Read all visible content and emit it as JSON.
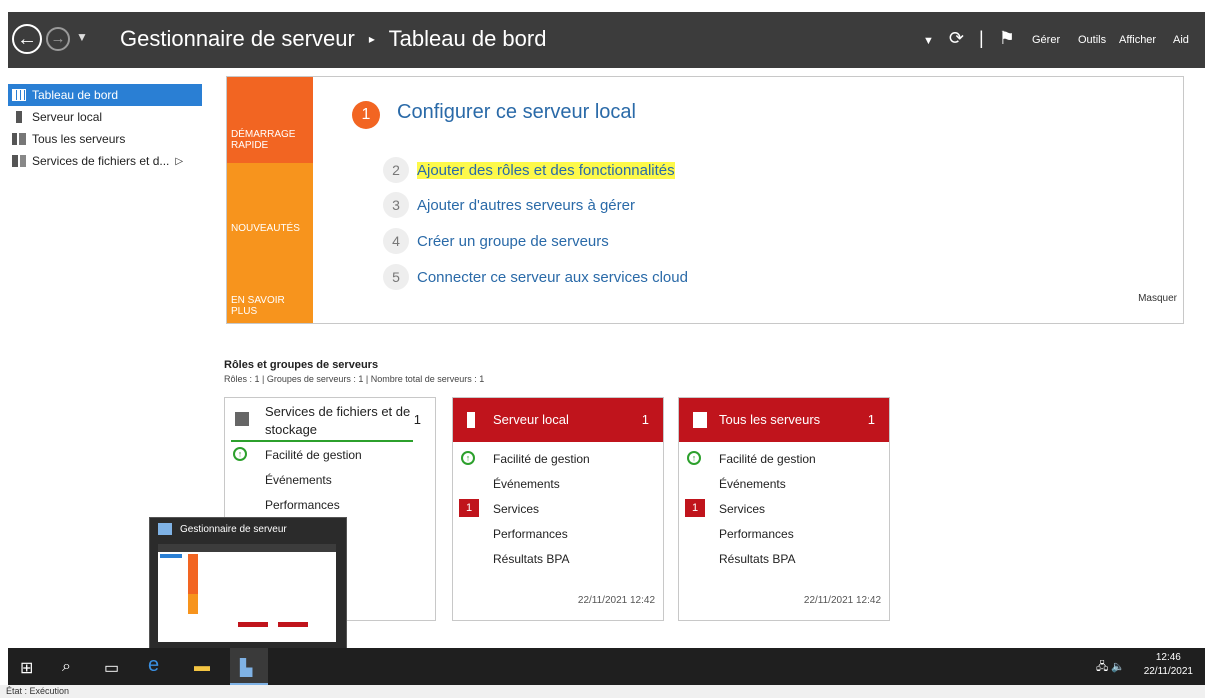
{
  "topbar": {
    "breadcrumb_root": "Gestionnaire de serveur",
    "breadcrumb_sep": "▸",
    "breadcrumb_page": "Tableau de bord",
    "menu": [
      "Gérer",
      "Outils",
      "Afficher",
      "Aid"
    ]
  },
  "sidebar": {
    "items": [
      {
        "label": "Tableau de bord",
        "icon": "dashboard-grid-icon",
        "active": true
      },
      {
        "label": "Serveur local",
        "icon": "server-icon"
      },
      {
        "label": "Tous les serveurs",
        "icon": "servers-icon"
      },
      {
        "label": "Services de fichiers et d...",
        "icon": "file-services-icon",
        "arrow": "▷"
      }
    ]
  },
  "welcome": {
    "strips": [
      "DÉMARRAGE RAPIDE",
      "NOUVEAUTÉS",
      "EN SAVOIR PLUS"
    ],
    "step1": {
      "num": "1",
      "label": "Configurer ce serveur local"
    },
    "steps": [
      {
        "num": "2",
        "label": "Ajouter des rôles et des fonctionnalités"
      },
      {
        "num": "3",
        "label": "Ajouter d'autres serveurs à gérer"
      },
      {
        "num": "4",
        "label": "Créer un groupe de serveurs"
      },
      {
        "num": "5",
        "label": "Connecter ce serveur aux services cloud"
      }
    ],
    "hide": "Masquer"
  },
  "roles": {
    "title": "Rôles et groupes de serveurs",
    "subtitle": "Rôles : 1   |   Groupes de serveurs : 1   |   Nombre total de serveurs : 1"
  },
  "tiles": [
    {
      "title": "Services de fichiers et de stockage",
      "count": "1",
      "rows": [
        "Facilité de gestion",
        "Événements",
        "Performances"
      ]
    },
    {
      "title": "Serveur local",
      "count": "1",
      "rows": [
        "Facilité de gestion",
        "Événements",
        "Services",
        "Performances",
        "Résultats BPA"
      ],
      "services_badge": "1",
      "timestamp": "22/11/2021 12:42"
    },
    {
      "title": "Tous les serveurs",
      "count": "1",
      "rows": [
        "Facilité de gestion",
        "Événements",
        "Services",
        "Performances",
        "Résultats BPA"
      ],
      "services_badge": "1",
      "timestamp": "22/11/2021 12:42"
    }
  ],
  "preview": {
    "title": "Gestionnaire de serveur"
  },
  "taskbar": {
    "time": "12:46",
    "date": "22/11/2021"
  },
  "status": "État : Exécution",
  "colors": {
    "accent": "#2a7fd4",
    "orange": "#f26522",
    "red": "#c0141c"
  }
}
